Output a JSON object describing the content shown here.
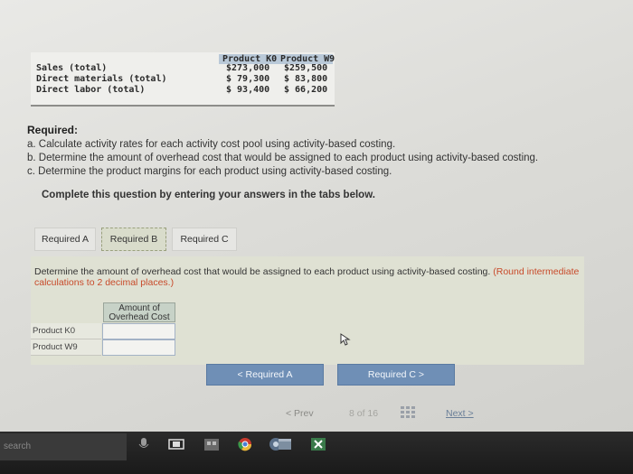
{
  "table": {
    "header": {
      "col1": "Product K0",
      "col2": "Product W9"
    },
    "rows": [
      {
        "label": "Sales (total)",
        "col1": "$273,000",
        "col2": "$259,500"
      },
      {
        "label": "Direct materials (total)",
        "col1": "$ 79,300",
        "col2": "$ 83,800"
      },
      {
        "label": "Direct labor (total)",
        "col1": "$ 93,400",
        "col2": "$ 66,200"
      }
    ]
  },
  "required": {
    "title": "Required:",
    "items": [
      "a. Calculate activity rates for each activity cost pool using activity-based costing.",
      "b. Determine the amount of overhead cost that would be assigned to each product using activity-based costing.",
      "c. Determine the product margins for each product using activity-based costing."
    ]
  },
  "complete_msg": "Complete this question by entering your answers in the tabs below.",
  "tabs": [
    "Required A",
    "Required B",
    "Required C"
  ],
  "active_tab": "Required B",
  "instruction": {
    "main": "Determine the amount of overhead cost that would be assigned to each product using activity-based costing.",
    "note": "(Round intermediate calculations to 2 decimal places.)"
  },
  "answer_table": {
    "header_line1": "Amount of",
    "header_line2": "Overhead Cost",
    "rows": [
      {
        "label": "Product K0",
        "value": ""
      },
      {
        "label": "Product W9",
        "value": ""
      }
    ]
  },
  "nav_buttons": {
    "prev": "< Required A",
    "next": "Required C >"
  },
  "pager": {
    "prev": "< Prev",
    "indicator": "8 of 16",
    "next": "Next >"
  },
  "taskbar": {
    "search": "search"
  },
  "colors": {
    "button_blue": "#6f8fb6",
    "active_tab_bg": "#d9dccb",
    "note_red": "#c84a2a"
  }
}
